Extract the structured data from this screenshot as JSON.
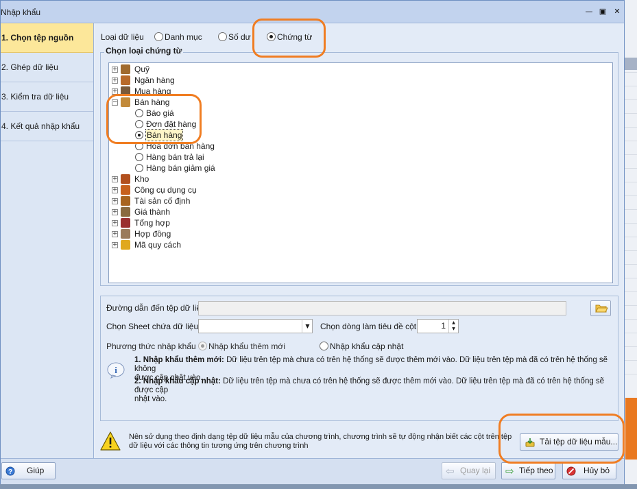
{
  "window": {
    "title": "Nhập khẩu",
    "min_glyph": "—",
    "max_glyph": "▣",
    "close_glyph": "✕"
  },
  "steps": [
    {
      "label": "1. Chọn tệp nguồn"
    },
    {
      "label": "2. Ghép dữ liệu"
    },
    {
      "label": "3. Kiểm tra dữ liệu"
    },
    {
      "label": "4. Kết quả nhập khẩu"
    }
  ],
  "data_type": {
    "label": "Loại dữ liệu",
    "options": [
      "Danh mục",
      "Số dư",
      "Chứng từ"
    ],
    "selected": "Chứng từ"
  },
  "voucher_group": {
    "title": "Chọn loại chứng từ",
    "tree": [
      {
        "label": "Quỹ",
        "icon": "cash-icon",
        "color": "#a06a2e"
      },
      {
        "label": "Ngân hàng",
        "icon": "bank-icon",
        "color": "#b86a2a"
      },
      {
        "label": "Mua hàng",
        "icon": "purchase-icon",
        "color": "#7a5a3a"
      },
      {
        "label": "Bán hàng",
        "icon": "sales-icon",
        "color": "#c28a3a",
        "expanded": true,
        "children": [
          "Báo giá",
          "Đơn đặt hàng",
          "Bán hàng",
          "Hóa đơn bán hàng",
          "Hàng bán trả lại",
          "Hàng bán giảm giá"
        ],
        "selected_child": "Bán hàng"
      },
      {
        "label": "Kho",
        "icon": "warehouse-icon",
        "color": "#b2501e"
      },
      {
        "label": "Công cụ dụng cụ",
        "icon": "tools-icon",
        "color": "#c7611d"
      },
      {
        "label": "Tài sản cố định",
        "icon": "fixed-asset-icon",
        "color": "#a8641f"
      },
      {
        "label": "Giá thành",
        "icon": "cost-icon",
        "color": "#8a6a3f"
      },
      {
        "label": "Tổng hợp",
        "icon": "summary-icon",
        "color": "#9a2f2f"
      },
      {
        "label": "Hợp đồng",
        "icon": "contract-icon",
        "color": "#9a7a5a"
      },
      {
        "label": "Mã quy cách",
        "icon": "spec-code-icon",
        "color": "#e0a81e"
      }
    ]
  },
  "file": {
    "path_label": "Đường dẫn đến tệp dữ liệu",
    "path_value": "",
    "sheet_label": "Chọn Sheet chứa dữ liệu",
    "sheet_value": "",
    "header_row_label": "Chọn dòng làm tiêu đề cột",
    "header_row_value": "1",
    "method_label": "Phương thức nhập khẩu",
    "method_options": [
      "Nhập khẩu thêm mới",
      "Nhập khẩu cập nhật"
    ],
    "method_selected": "Nhập khẩu thêm mới"
  },
  "notes": {
    "n1_title": "1. Nhập khẩu thêm mới:",
    "n1_text_a": " Dữ liệu trên tệp mà chưa có trên hệ thống sẽ được thêm mới vào. Dữ liệu trên tệp mà đã có trên hệ thống sẽ không",
    "n1_text_b": "được cập nhật vào.",
    "n2_title": "2. Nhập khẩu cập nhật:",
    "n2_text_a": " Dữ liệu trên tệp mà chưa có trên hệ thống sẽ được thêm mới vào. Dữ liệu trên tệp mà đã có trên hệ thống sẽ được cập",
    "n2_text_b": "nhật vào."
  },
  "warning": {
    "line1": "Nên sử dụng theo định dạng tệp dữ liệu mẫu của chương trình, chương trình sẽ tự động nhận biết các cột trên tệp",
    "line2": "dữ liệu với các thông tin tương ứng trên chương trình",
    "download_label": "Tải tệp dữ liệu mẫu..."
  },
  "footer": {
    "help": "Giúp",
    "back": "Quay lại",
    "next": "Tiếp theo",
    "cancel": "Hủy bỏ"
  },
  "colors": {
    "highlight": "#f07d22",
    "active_step": "#fce79a"
  }
}
